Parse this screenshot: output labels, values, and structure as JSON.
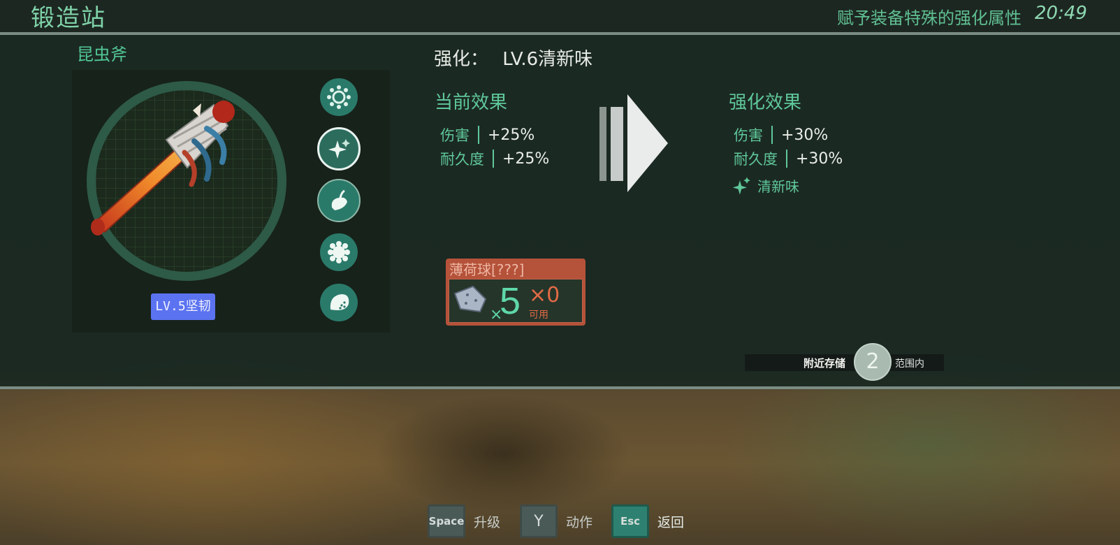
{
  "header": {
    "title": "锻造站",
    "subtitle": "赋予装备特殊的强化属性",
    "clock": "20:49"
  },
  "item": {
    "name": "昆虫斧",
    "level_badge": "LV.5坚韧"
  },
  "mods": [
    {
      "icon": "gear-icon"
    },
    {
      "icon": "sparkle-icon",
      "selected": true
    },
    {
      "icon": "pepper-icon"
    },
    {
      "icon": "splat-icon"
    },
    {
      "icon": "seed-icon"
    }
  ],
  "upgrade": {
    "label": "强化：",
    "value": "LV.6清新味"
  },
  "current": {
    "heading": "当前效果",
    "stats": [
      {
        "label": "伤害",
        "value": "+25%"
      },
      {
        "label": "耐久度",
        "value": "+25%"
      }
    ]
  },
  "after": {
    "heading": "强化效果",
    "stats": [
      {
        "label": "伤害",
        "value": "+30%"
      },
      {
        "label": "耐久度",
        "value": "+30%"
      }
    ],
    "effect": "清新味"
  },
  "material": {
    "name": "薄荷球[???]",
    "x_prefix": "×",
    "required": "5",
    "owned": "×0",
    "owned_label": "可用"
  },
  "storage": {
    "label": "附近存储",
    "count": "2",
    "range": "范围内"
  },
  "controls": [
    {
      "key": "Space",
      "action": "升级"
    },
    {
      "key": "Y",
      "action": "动作"
    },
    {
      "key": "Esc",
      "action": "返回"
    }
  ],
  "colors": {
    "accent": "#5fc89a",
    "badge": "#5b73f0",
    "material": "#b5523a",
    "owned": "#e36a46"
  }
}
